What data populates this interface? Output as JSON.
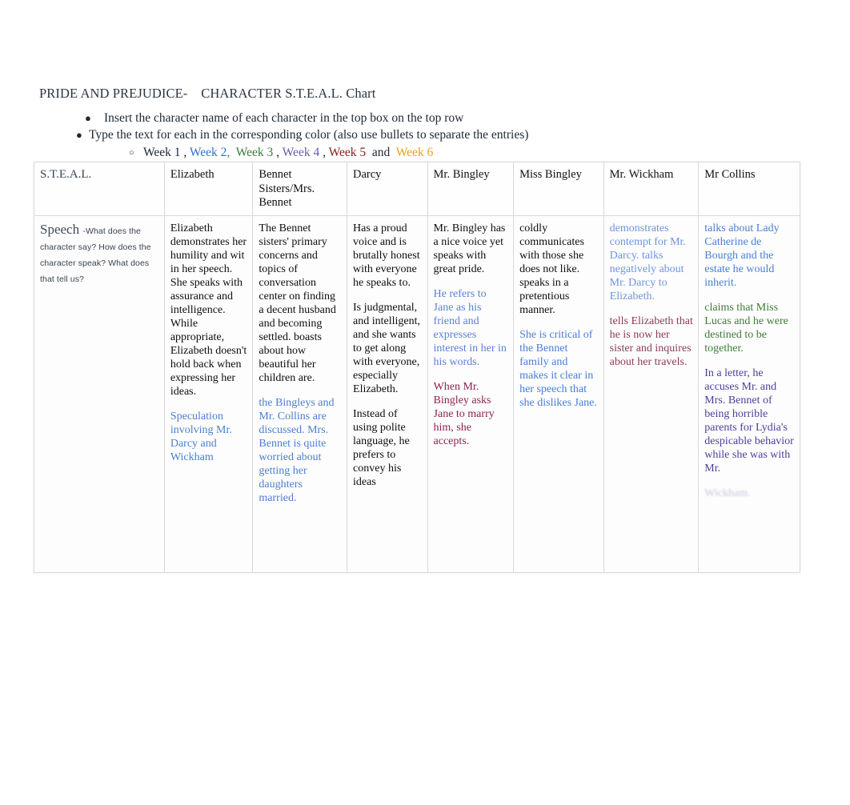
{
  "document": {
    "title": "PRIDE AND PREJUDICE-    CHARACTER S.T.E.A.L. Chart"
  },
  "instructions": {
    "bullet_glyph": "●",
    "sub_bullet_glyph": "○",
    "items": [
      "Insert the character name of each character in the top box on the top row",
      "Type the text for each in the corresponding color (also use bullets to separate the entries)"
    ],
    "weeks_prefix": "",
    "weeks": [
      {
        "label": "Week 1",
        "color": "#1d2733",
        "after": " , "
      },
      {
        "label": "Week 2,",
        "color": "#2a6fd6",
        "after": "  "
      },
      {
        "label": "Week 3",
        "color": "#3c7a33",
        "after": " , "
      },
      {
        "label": "Week 4",
        "color": "#6b5ca8",
        "after": " , "
      },
      {
        "label": "Week 5",
        "color": "#8c1a1a",
        "after": "  "
      },
      {
        "label": "and",
        "color": "#1d2733",
        "after": "  "
      },
      {
        "label": "Week 6",
        "color": "#e8a020",
        "after": ""
      }
    ]
  },
  "table": {
    "headers": [
      "S.T.E.A.L.",
      "Elizabeth",
      "Bennet Sisters/Mrs. Bennet",
      "Darcy",
      "Mr. Bingley",
      "Miss Bingley",
      "Mr. Wickham",
      "Mr Collins"
    ],
    "rows": [
      {
        "label": "Speech",
        "label_dash": "-",
        "prompt": "What does the character say? How does the character speak?        What does that tell us?",
        "cells": [
          {
            "character": "Elizabeth",
            "clipped": false,
            "paragraphs": [
              {
                "text": "Elizabeth demonstrates her humility and wit in her speech. She speaks with assurance and intelligence. While appropriate, Elizabeth doesn't hold back when expressing her ideas.",
                "color": "#0d0d0d"
              },
              {
                "text": "Speculation involving Mr. Darcy and Wickham",
                "color": "#4a7ed1"
              }
            ]
          },
          {
            "character": "Bennet Sisters/Mrs. Bennet",
            "clipped": false,
            "paragraphs": [
              {
                "text": "The Bennet sisters' primary concerns and topics of conversation center on finding a decent husband and becoming settled. boasts about how beautiful her children are.",
                "color": "#0d0d0d"
              },
              {
                "text": "the Bingleys and Mr. Collins are discussed. Mrs. Bennet is quite worried about getting her daughters married.",
                "color": "#4a7ed1"
              }
            ]
          },
          {
            "character": "Darcy",
            "clipped": true,
            "paragraphs": [
              {
                "text": "Has a proud voice and is brutally honest with everyone he speaks to.",
                "color": "#0d0d0d"
              },
              {
                "text": "Is judgmental, and intelligent, and she wants to get along with everyone, especially Elizabeth.",
                "color": "#0d0d0d"
              },
              {
                "text": "Instead of using polite language, he prefers to convey his ideas",
                "color": "#0d0d0d"
              }
            ]
          },
          {
            "character": "Mr. Bingley",
            "clipped": false,
            "paragraphs": [
              {
                "text": "Mr. Bingley has a nice voice yet speaks with great pride.",
                "color": "#0d0d0d"
              },
              {
                "text": "He refers to Jane as his friend and expresses interest in her in his words.",
                "color": "#5b7fd4"
              },
              {
                "text": "When Mr. Bingley asks Jane to marry him, she accepts.",
                "color": "#8c2250"
              }
            ]
          },
          {
            "character": "Miss Bingley",
            "clipped": false,
            "paragraphs": [
              {
                "text": "coldly communicates with those she does not like. speaks in a pretentious manner.",
                "color": "#0d0d0d"
              },
              {
                "text": "She is critical of the Bennet family and makes it clear in her speech that she dislikes Jane.",
                "color": "#4a7ed1"
              }
            ]
          },
          {
            "character": "Mr. Wickham",
            "clipped": false,
            "paragraphs": [
              {
                "text": "demonstrates contempt for Mr. Darcy. talks negatively about Mr. Darcy to Elizabeth.",
                "color": "#6f93dd"
              },
              {
                "text": "tells Elizabeth that he is now her sister and inquires about her travels.",
                "color": "#8c3a5a"
              }
            ]
          },
          {
            "character": "Mr Collins",
            "clipped": true,
            "paragraphs": [
              {
                "text": "talks about Lady Catherine de Bourgh and the estate he would inherit.",
                "color": "#4a7ed1"
              },
              {
                "text": "claims that Miss Lucas and he were destined to be together.",
                "color": "#3f7a39"
              },
              {
                "text": "In a letter, he accuses Mr. and Mrs. Bennet of being horrible parents for Lydia's despicable behavior while she was with Mr.",
                "color": "#4c3f99"
              },
              {
                "text": "Wickham.",
                "color": "#4c3f99",
                "faded": true
              }
            ]
          }
        ]
      }
    ]
  }
}
